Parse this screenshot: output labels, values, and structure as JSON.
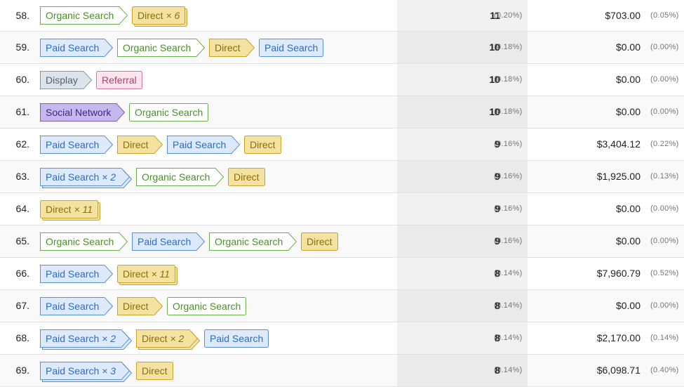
{
  "channel_colors": {
    "organic": {
      "fill": "#ffffff",
      "stroke": "#6ab04c",
      "text": "#4a8f2a"
    },
    "direct": {
      "fill": "#f4e2a0",
      "stroke": "#c9a32a",
      "text": "#8a6d10"
    },
    "paid": {
      "fill": "#dceafc",
      "stroke": "#5b8fd6",
      "text": "#2f6bc2"
    },
    "display": {
      "fill": "#dde3ea",
      "stroke": "#8a97a6",
      "text": "#555f6b"
    },
    "referral": {
      "fill": "#fde4ee",
      "stroke": "#d77a9c",
      "text": "#a04a6a"
    },
    "social": {
      "fill": "#c8b6ee",
      "stroke": "#7a5cc0",
      "text": "#3d2780"
    }
  },
  "rows": [
    {
      "num": "58.",
      "conv": "11",
      "conv_pct": "(0.20%)",
      "rev": "$703.00",
      "rev_pct": "(0.05%)",
      "path": [
        {
          "label": "Organic Search",
          "ch": "organic"
        },
        {
          "label": "Direct",
          "ch": "direct",
          "mult": "× 6"
        }
      ]
    },
    {
      "num": "59.",
      "conv": "10",
      "conv_pct": "(0.18%)",
      "rev": "$0.00",
      "rev_pct": "(0.00%)",
      "path": [
        {
          "label": "Paid Search",
          "ch": "paid"
        },
        {
          "label": "Organic Search",
          "ch": "organic"
        },
        {
          "label": "Direct",
          "ch": "direct"
        },
        {
          "label": "Paid Search",
          "ch": "paid"
        }
      ]
    },
    {
      "num": "60.",
      "conv": "10",
      "conv_pct": "(0.18%)",
      "rev": "$0.00",
      "rev_pct": "(0.00%)",
      "path": [
        {
          "label": "Display",
          "ch": "display"
        },
        {
          "label": "Referral",
          "ch": "referral"
        }
      ]
    },
    {
      "num": "61.",
      "conv": "10",
      "conv_pct": "(0.18%)",
      "rev": "$0.00",
      "rev_pct": "(0.00%)",
      "path": [
        {
          "label": "Social Network",
          "ch": "social"
        },
        {
          "label": "Organic Search",
          "ch": "organic"
        }
      ]
    },
    {
      "num": "62.",
      "conv": "9",
      "conv_pct": "(0.16%)",
      "rev": "$3,404.12",
      "rev_pct": "(0.22%)",
      "path": [
        {
          "label": "Paid Search",
          "ch": "paid"
        },
        {
          "label": "Direct",
          "ch": "direct"
        },
        {
          "label": "Paid Search",
          "ch": "paid"
        },
        {
          "label": "Direct",
          "ch": "direct"
        }
      ]
    },
    {
      "num": "63.",
      "conv": "9",
      "conv_pct": "(0.16%)",
      "rev": "$1,925.00",
      "rev_pct": "(0.13%)",
      "path": [
        {
          "label": "Paid Search",
          "ch": "paid",
          "mult": "× 2"
        },
        {
          "label": "Organic Search",
          "ch": "organic"
        },
        {
          "label": "Direct",
          "ch": "direct"
        }
      ]
    },
    {
      "num": "64.",
      "conv": "9",
      "conv_pct": "(0.16%)",
      "rev": "$0.00",
      "rev_pct": "(0.00%)",
      "path": [
        {
          "label": "Direct",
          "ch": "direct",
          "mult": "× 11"
        }
      ]
    },
    {
      "num": "65.",
      "conv": "9",
      "conv_pct": "(0.16%)",
      "rev": "$0.00",
      "rev_pct": "(0.00%)",
      "path": [
        {
          "label": "Organic Search",
          "ch": "organic"
        },
        {
          "label": "Paid Search",
          "ch": "paid"
        },
        {
          "label": "Organic Search",
          "ch": "organic"
        },
        {
          "label": "Direct",
          "ch": "direct"
        }
      ]
    },
    {
      "num": "66.",
      "conv": "8",
      "conv_pct": "(0.14%)",
      "rev": "$7,960.79",
      "rev_pct": "(0.52%)",
      "path": [
        {
          "label": "Paid Search",
          "ch": "paid"
        },
        {
          "label": "Direct",
          "ch": "direct",
          "mult": "× 11"
        }
      ]
    },
    {
      "num": "67.",
      "conv": "8",
      "conv_pct": "(0.14%)",
      "rev": "$0.00",
      "rev_pct": "(0.00%)",
      "path": [
        {
          "label": "Paid Search",
          "ch": "paid"
        },
        {
          "label": "Direct",
          "ch": "direct"
        },
        {
          "label": "Organic Search",
          "ch": "organic"
        }
      ]
    },
    {
      "num": "68.",
      "conv": "8",
      "conv_pct": "(0.14%)",
      "rev": "$2,170.00",
      "rev_pct": "(0.14%)",
      "path": [
        {
          "label": "Paid Search",
          "ch": "paid",
          "mult": "× 2"
        },
        {
          "label": "Direct",
          "ch": "direct",
          "mult": "× 2"
        },
        {
          "label": "Paid Search",
          "ch": "paid"
        }
      ]
    },
    {
      "num": "69.",
      "conv": "8",
      "conv_pct": "(0.14%)",
      "rev": "$6,098.71",
      "rev_pct": "(0.40%)",
      "path": [
        {
          "label": "Paid Search",
          "ch": "paid",
          "mult": "× 3"
        },
        {
          "label": "Direct",
          "ch": "direct"
        }
      ]
    }
  ]
}
